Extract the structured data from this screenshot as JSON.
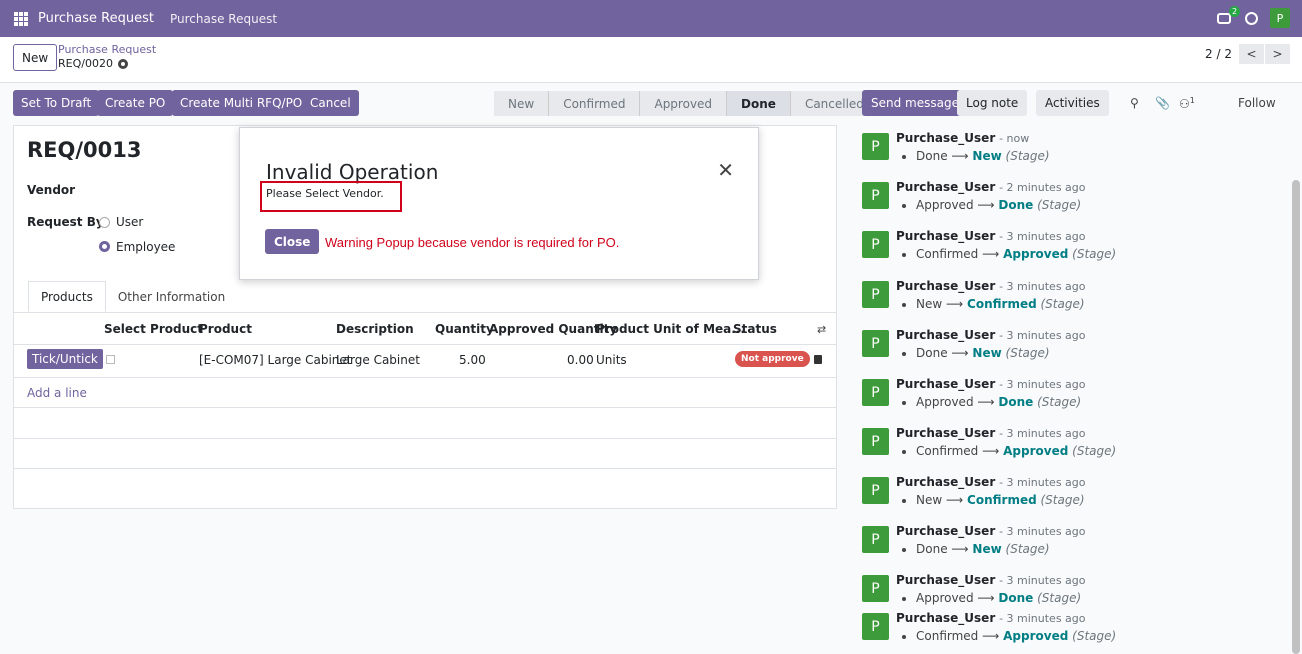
{
  "navbar": {
    "app_name": "Purchase Request",
    "menu_item": "Purchase Request",
    "chat_badge": "2",
    "user_initial": "P"
  },
  "control": {
    "new_label": "New",
    "breadcrumb_parent": "Purchase Request",
    "breadcrumb_current": "REQ/0020",
    "pager_value": "2 / 2",
    "pager_prev": "<",
    "pager_next": ">"
  },
  "actions": [
    "Set To Draft",
    "Create PO",
    "Create Multi RFQ/PO",
    "Cancel"
  ],
  "stages": [
    {
      "label": "New",
      "active": false
    },
    {
      "label": "Confirmed",
      "active": false
    },
    {
      "label": "Approved",
      "active": false
    },
    {
      "label": "Done",
      "active": true
    },
    {
      "label": "Cancelled",
      "active": false
    }
  ],
  "chatter_header": {
    "send_message": "Send message",
    "log_note": "Log note",
    "activities": "Activities",
    "followers_count": "1",
    "follow": "Follow"
  },
  "form": {
    "title": "REQ/0013",
    "vendor_label": "Vendor",
    "request_by_label": "Request By",
    "options": [
      {
        "label": "User",
        "checked": false
      },
      {
        "label": "Employee",
        "checked": true
      }
    ],
    "tabs": [
      "Products",
      "Other Information"
    ],
    "columns": [
      "Select Product",
      "Product",
      "Description",
      "Quantity",
      "Approved Quantity",
      "Product Unit of Mea...",
      "Status"
    ],
    "row": {
      "tick_label": "Tick/Untick",
      "product": "[E-COM07] Large Cabinet",
      "description": "Large Cabinet",
      "quantity": "5.00",
      "approved_quantity": "0.00",
      "uom": "Units",
      "status": "Not approve"
    },
    "add_line": "Add a line"
  },
  "messages": [
    {
      "author": "Purchase_User",
      "time": "- now",
      "old": "Done",
      "new": "New",
      "field": "(Stage)"
    },
    {
      "author": "Purchase_User",
      "time": "- 2 minutes ago",
      "old": "Approved",
      "new": "Done",
      "field": "(Stage)"
    },
    {
      "author": "Purchase_User",
      "time": "- 3 minutes ago",
      "old": "Confirmed",
      "new": "Approved",
      "field": "(Stage)"
    },
    {
      "author": "Purchase_User",
      "time": "- 3 minutes ago",
      "old": "New",
      "new": "Confirmed",
      "field": "(Stage)"
    },
    {
      "author": "Purchase_User",
      "time": "- 3 minutes ago",
      "old": "Done",
      "new": "New",
      "field": "(Stage)"
    },
    {
      "author": "Purchase_User",
      "time": "- 3 minutes ago",
      "old": "Approved",
      "new": "Done",
      "field": "(Stage)"
    },
    {
      "author": "Purchase_User",
      "time": "- 3 minutes ago",
      "old": "Confirmed",
      "new": "Approved",
      "field": "(Stage)"
    },
    {
      "author": "Purchase_User",
      "time": "- 3 minutes ago",
      "old": "New",
      "new": "Confirmed",
      "field": "(Stage)"
    },
    {
      "author": "Purchase_User",
      "time": "- 3 minutes ago",
      "old": "Done",
      "new": "New",
      "field": "(Stage)"
    },
    {
      "author": "Purchase_User",
      "time": "- 3 minutes ago",
      "old": "Approved",
      "new": "Done",
      "field": "(Stage)"
    },
    {
      "author": "Purchase_User",
      "time": "- 3 minutes ago",
      "old": "Confirmed",
      "new": "Approved",
      "field": "(Stage)"
    }
  ],
  "modal": {
    "title": "Invalid Operation",
    "message": "Please Select Vendor.",
    "close_label": "Close",
    "annotation": "Warning Popup  because  vendor is required for PO."
  },
  "colors": {
    "brand": "#71639e",
    "avatar": "#3e9b3b",
    "annotation": "#d0021b",
    "link_value": "#017e84"
  }
}
